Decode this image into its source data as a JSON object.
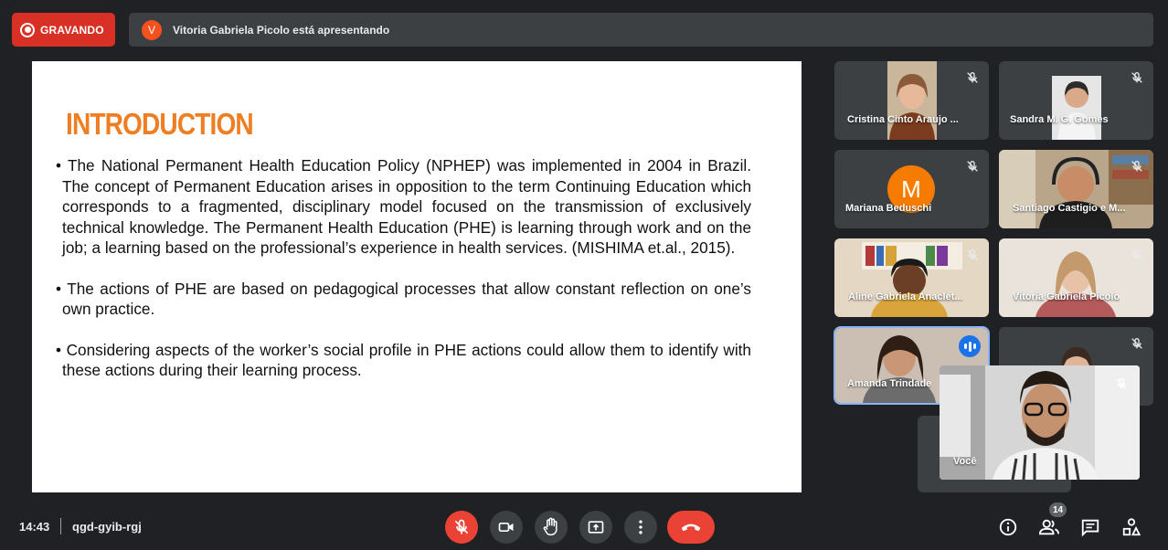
{
  "top_bar": {
    "recording_label": "GRAVANDO",
    "presenter_initial": "V",
    "presenter_text": "Vitoria Gabriela Picolo está apresentando"
  },
  "slide": {
    "title": "INTRODUCTION",
    "bullets": [
      "• The National Permanent Health Education Policy (NPHEP) was implemented in 2004 in Brazil. The concept of Permanent Education arises in opposition to the term Continuing Education which corresponds to a fragmented, disciplinary model focused on the transmission of exclusively technical knowledge. The Permanent Health Education (PHE) is learning through work and on the job; a learning based on the professional’s experience in health services. (MISHIMA et.al., 2015).",
      "• The actions of PHE are based on pedagogical processes that allow constant reflection on one’s own practice.",
      "• Considering aspects of the worker’s social profile in PHE actions could allow them to identify with these actions during their learning process."
    ]
  },
  "participants": [
    {
      "name": "Cristina Cinto Araujo ...",
      "muted": true
    },
    {
      "name": "Sandra M. G. Gomes",
      "muted": true
    },
    {
      "name": "Mariana Beduschi",
      "muted": true,
      "avatar_letter": "M"
    },
    {
      "name": "Santiago Castigio e M...",
      "muted": true
    },
    {
      "name": "Aline Gabriela Anaclet...",
      "muted": true
    },
    {
      "name": "Vitoria Gabriela Picolo",
      "muted": true
    },
    {
      "name": "Amanda Trindade",
      "muted": false,
      "speaking": true
    },
    {
      "name": "",
      "muted": true
    }
  ],
  "self_view": {
    "name": "Você",
    "muted": true
  },
  "bottom_bar": {
    "time": "14:43",
    "meeting_code": "qgd-gyib-rgj",
    "participant_count": "14"
  },
  "colors": {
    "background": "#202124",
    "recording_red": "#d93025",
    "end_call_red": "#ea4335",
    "slide_title_orange": "#ef7d22",
    "speaking_blue": "#1a73e8"
  },
  "icons": [
    "record-icon",
    "mic-off-icon",
    "camera-icon",
    "raise-hand-icon",
    "present-screen-icon",
    "more-options-icon",
    "end-call-icon",
    "info-icon",
    "people-icon",
    "chat-icon",
    "activities-icon"
  ]
}
